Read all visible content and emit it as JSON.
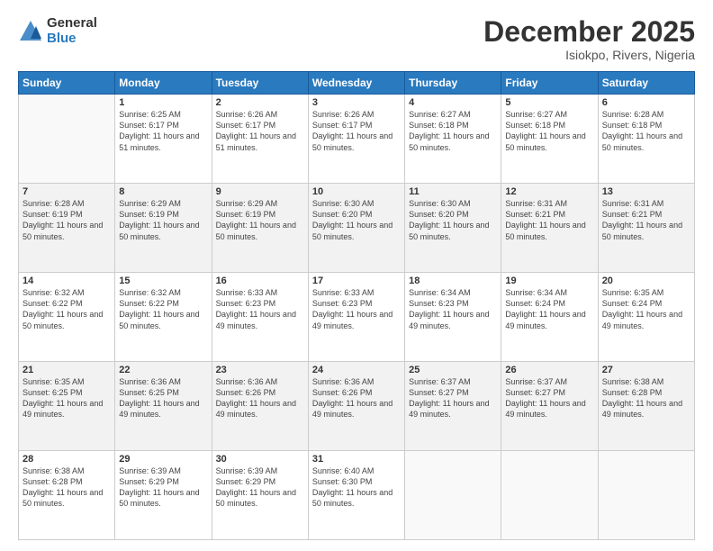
{
  "logo": {
    "general": "General",
    "blue": "Blue"
  },
  "title": "December 2025",
  "subtitle": "Isiokpo, Rivers, Nigeria",
  "days_header": [
    "Sunday",
    "Monday",
    "Tuesday",
    "Wednesday",
    "Thursday",
    "Friday",
    "Saturday"
  ],
  "weeks": [
    {
      "shaded": false,
      "days": [
        {
          "num": "",
          "sunrise": "",
          "sunset": "",
          "daylight": "",
          "empty": true
        },
        {
          "num": "1",
          "sunrise": "Sunrise: 6:25 AM",
          "sunset": "Sunset: 6:17 PM",
          "daylight": "Daylight: 11 hours and 51 minutes."
        },
        {
          "num": "2",
          "sunrise": "Sunrise: 6:26 AM",
          "sunset": "Sunset: 6:17 PM",
          "daylight": "Daylight: 11 hours and 51 minutes."
        },
        {
          "num": "3",
          "sunrise": "Sunrise: 6:26 AM",
          "sunset": "Sunset: 6:17 PM",
          "daylight": "Daylight: 11 hours and 50 minutes."
        },
        {
          "num": "4",
          "sunrise": "Sunrise: 6:27 AM",
          "sunset": "Sunset: 6:18 PM",
          "daylight": "Daylight: 11 hours and 50 minutes."
        },
        {
          "num": "5",
          "sunrise": "Sunrise: 6:27 AM",
          "sunset": "Sunset: 6:18 PM",
          "daylight": "Daylight: 11 hours and 50 minutes."
        },
        {
          "num": "6",
          "sunrise": "Sunrise: 6:28 AM",
          "sunset": "Sunset: 6:18 PM",
          "daylight": "Daylight: 11 hours and 50 minutes."
        }
      ]
    },
    {
      "shaded": true,
      "days": [
        {
          "num": "7",
          "sunrise": "Sunrise: 6:28 AM",
          "sunset": "Sunset: 6:19 PM",
          "daylight": "Daylight: 11 hours and 50 minutes."
        },
        {
          "num": "8",
          "sunrise": "Sunrise: 6:29 AM",
          "sunset": "Sunset: 6:19 PM",
          "daylight": "Daylight: 11 hours and 50 minutes."
        },
        {
          "num": "9",
          "sunrise": "Sunrise: 6:29 AM",
          "sunset": "Sunset: 6:19 PM",
          "daylight": "Daylight: 11 hours and 50 minutes."
        },
        {
          "num": "10",
          "sunrise": "Sunrise: 6:30 AM",
          "sunset": "Sunset: 6:20 PM",
          "daylight": "Daylight: 11 hours and 50 minutes."
        },
        {
          "num": "11",
          "sunrise": "Sunrise: 6:30 AM",
          "sunset": "Sunset: 6:20 PM",
          "daylight": "Daylight: 11 hours and 50 minutes."
        },
        {
          "num": "12",
          "sunrise": "Sunrise: 6:31 AM",
          "sunset": "Sunset: 6:21 PM",
          "daylight": "Daylight: 11 hours and 50 minutes."
        },
        {
          "num": "13",
          "sunrise": "Sunrise: 6:31 AM",
          "sunset": "Sunset: 6:21 PM",
          "daylight": "Daylight: 11 hours and 50 minutes."
        }
      ]
    },
    {
      "shaded": false,
      "days": [
        {
          "num": "14",
          "sunrise": "Sunrise: 6:32 AM",
          "sunset": "Sunset: 6:22 PM",
          "daylight": "Daylight: 11 hours and 50 minutes."
        },
        {
          "num": "15",
          "sunrise": "Sunrise: 6:32 AM",
          "sunset": "Sunset: 6:22 PM",
          "daylight": "Daylight: 11 hours and 50 minutes."
        },
        {
          "num": "16",
          "sunrise": "Sunrise: 6:33 AM",
          "sunset": "Sunset: 6:23 PM",
          "daylight": "Daylight: 11 hours and 49 minutes."
        },
        {
          "num": "17",
          "sunrise": "Sunrise: 6:33 AM",
          "sunset": "Sunset: 6:23 PM",
          "daylight": "Daylight: 11 hours and 49 minutes."
        },
        {
          "num": "18",
          "sunrise": "Sunrise: 6:34 AM",
          "sunset": "Sunset: 6:23 PM",
          "daylight": "Daylight: 11 hours and 49 minutes."
        },
        {
          "num": "19",
          "sunrise": "Sunrise: 6:34 AM",
          "sunset": "Sunset: 6:24 PM",
          "daylight": "Daylight: 11 hours and 49 minutes."
        },
        {
          "num": "20",
          "sunrise": "Sunrise: 6:35 AM",
          "sunset": "Sunset: 6:24 PM",
          "daylight": "Daylight: 11 hours and 49 minutes."
        }
      ]
    },
    {
      "shaded": true,
      "days": [
        {
          "num": "21",
          "sunrise": "Sunrise: 6:35 AM",
          "sunset": "Sunset: 6:25 PM",
          "daylight": "Daylight: 11 hours and 49 minutes."
        },
        {
          "num": "22",
          "sunrise": "Sunrise: 6:36 AM",
          "sunset": "Sunset: 6:25 PM",
          "daylight": "Daylight: 11 hours and 49 minutes."
        },
        {
          "num": "23",
          "sunrise": "Sunrise: 6:36 AM",
          "sunset": "Sunset: 6:26 PM",
          "daylight": "Daylight: 11 hours and 49 minutes."
        },
        {
          "num": "24",
          "sunrise": "Sunrise: 6:36 AM",
          "sunset": "Sunset: 6:26 PM",
          "daylight": "Daylight: 11 hours and 49 minutes."
        },
        {
          "num": "25",
          "sunrise": "Sunrise: 6:37 AM",
          "sunset": "Sunset: 6:27 PM",
          "daylight": "Daylight: 11 hours and 49 minutes."
        },
        {
          "num": "26",
          "sunrise": "Sunrise: 6:37 AM",
          "sunset": "Sunset: 6:27 PM",
          "daylight": "Daylight: 11 hours and 49 minutes."
        },
        {
          "num": "27",
          "sunrise": "Sunrise: 6:38 AM",
          "sunset": "Sunset: 6:28 PM",
          "daylight": "Daylight: 11 hours and 49 minutes."
        }
      ]
    },
    {
      "shaded": false,
      "days": [
        {
          "num": "28",
          "sunrise": "Sunrise: 6:38 AM",
          "sunset": "Sunset: 6:28 PM",
          "daylight": "Daylight: 11 hours and 50 minutes."
        },
        {
          "num": "29",
          "sunrise": "Sunrise: 6:39 AM",
          "sunset": "Sunset: 6:29 PM",
          "daylight": "Daylight: 11 hours and 50 minutes."
        },
        {
          "num": "30",
          "sunrise": "Sunrise: 6:39 AM",
          "sunset": "Sunset: 6:29 PM",
          "daylight": "Daylight: 11 hours and 50 minutes."
        },
        {
          "num": "31",
          "sunrise": "Sunrise: 6:40 AM",
          "sunset": "Sunset: 6:30 PM",
          "daylight": "Daylight: 11 hours and 50 minutes."
        },
        {
          "num": "",
          "sunrise": "",
          "sunset": "",
          "daylight": "",
          "empty": true
        },
        {
          "num": "",
          "sunrise": "",
          "sunset": "",
          "daylight": "",
          "empty": true
        },
        {
          "num": "",
          "sunrise": "",
          "sunset": "",
          "daylight": "",
          "empty": true
        }
      ]
    }
  ]
}
